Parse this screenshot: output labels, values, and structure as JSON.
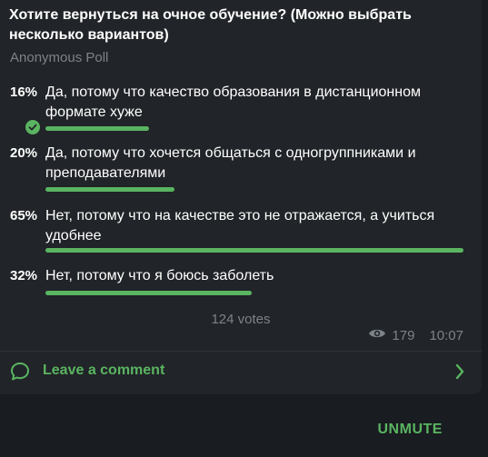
{
  "poll": {
    "question": "Хотите вернуться на очное обучение? (Можно выбрать несколько вариантов)",
    "type_label": "Anonymous Poll",
    "options": [
      {
        "percent_label": "16%",
        "percent": 16,
        "text": "Да, потому что качество образования в дистанционном формате хуже",
        "chosen": true
      },
      {
        "percent_label": "20%",
        "percent": 20,
        "text": "Да, потому что хочется общаться с одногруппниками и преподавателями",
        "chosen": false
      },
      {
        "percent_label": "65%",
        "percent": 65,
        "text": "Нет, потому что на качестве это не отражается, а учиться удобнее",
        "chosen": false
      },
      {
        "percent_label": "32%",
        "percent": 32,
        "text": "Нет, потому что я боюсь заболеть",
        "chosen": false
      }
    ],
    "votes_label": "124 votes",
    "views": "179",
    "time": "10:07"
  },
  "comments": {
    "label": "Leave a comment"
  },
  "footer": {
    "unmute_label": "UNMUTE"
  },
  "colors": {
    "accent": "#5ab461",
    "card_bg": "#212428",
    "page_bg": "#191c20",
    "muted_text": "#7d8389"
  },
  "icons": {
    "chosen": "check-icon",
    "views": "eye-icon",
    "comment": "comment-bubble-icon",
    "chevron": "chevron-right-icon"
  }
}
